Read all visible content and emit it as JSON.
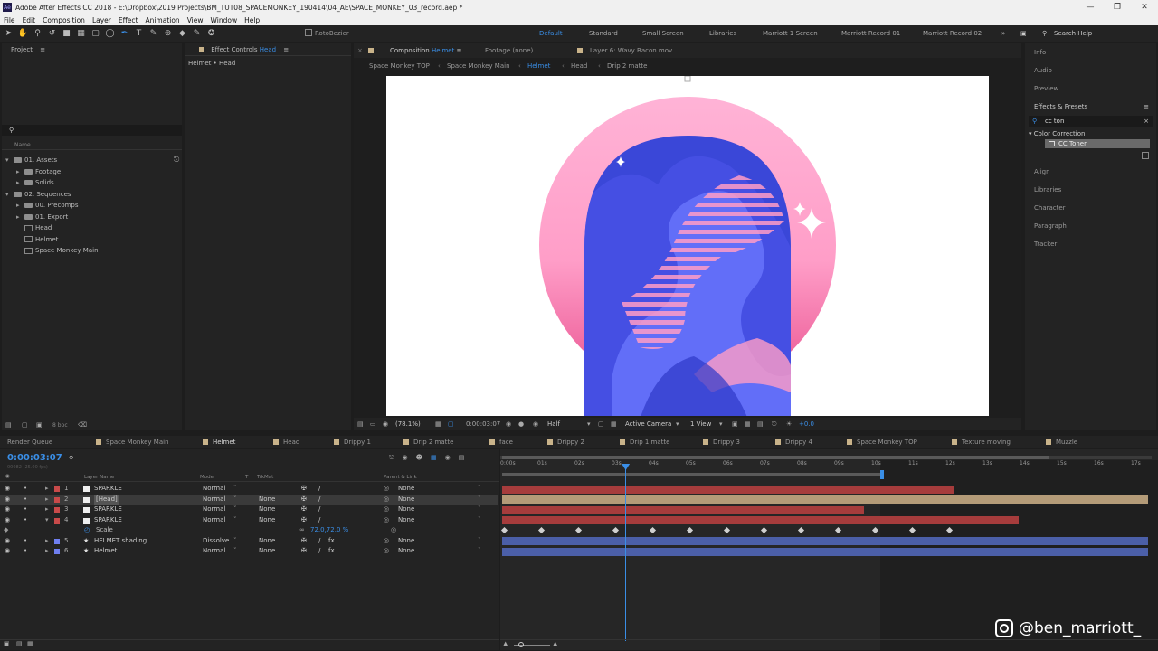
{
  "window": {
    "title": "Adobe After Effects CC 2018 - E:\\Dropbox\\2019 Projects\\BM_TUT08_SPACEMONKEY_190414\\04_AE\\SPACE_MONKEY_03_record.aep *",
    "logo": "Ae"
  },
  "menu": [
    "File",
    "Edit",
    "Composition",
    "Layer",
    "Effect",
    "Animation",
    "View",
    "Window",
    "Help"
  ],
  "toolbar": {
    "rotobezier": "RotoBezier",
    "workspaces": [
      "Default",
      "Standard",
      "Small Screen",
      "Libraries",
      "Marriott 1 Screen",
      "Marriott Record 01",
      "Marriott Record 02"
    ],
    "search_help": "Search Help"
  },
  "project": {
    "title": "Project",
    "search_placeholder": "",
    "column": "Name",
    "bpc": "8 bpc",
    "items": [
      {
        "label": "01. Assets",
        "type": "folder",
        "indent": 0,
        "open": true
      },
      {
        "label": "Footage",
        "type": "folder",
        "indent": 1
      },
      {
        "label": "Solids",
        "type": "folder",
        "indent": 1
      },
      {
        "label": "02. Sequences",
        "type": "folder",
        "indent": 0,
        "open": true
      },
      {
        "label": "00. Precomps",
        "type": "folder",
        "indent": 1
      },
      {
        "label": "01. Export",
        "type": "folder",
        "indent": 1
      },
      {
        "label": "Head",
        "type": "comp",
        "indent": 1
      },
      {
        "label": "Helmet",
        "type": "comp",
        "indent": 1
      },
      {
        "label": "Space Monkey Main",
        "type": "comp",
        "indent": 1
      }
    ]
  },
  "effect_controls": {
    "title": "Effect Controls",
    "layer": "Head",
    "subtitle": "Helmet • Head"
  },
  "composition": {
    "tab": "Composition",
    "name": "Helmet",
    "footage": "Footage (none)",
    "layer_tab": "Layer 6: Wavy Bacon.mov",
    "breadcrumbs": [
      "Space Monkey TOP",
      "Space Monkey Main",
      "Helmet",
      "Head",
      "Drip 2 matte"
    ],
    "zoom": "(78.1%)",
    "timecode": "0:00:03:07",
    "resolution": "Half",
    "camera": "Active Camera",
    "views": "1 View",
    "exposure": "+0.0"
  },
  "right_panel": {
    "items_top": [
      "Info",
      "Audio",
      "Preview"
    ],
    "effects_title": "Effects & Presets",
    "search": "cc ton",
    "category": "Color Correction",
    "result": "CC Toner",
    "items_bottom": [
      "Align",
      "Libraries",
      "Character",
      "Paragraph",
      "Tracker"
    ]
  },
  "timeline": {
    "tabs": [
      {
        "label": "Render Queue",
        "color": "",
        "active": false
      },
      {
        "label": "Space Monkey Main",
        "color": "#c9b38a",
        "active": false
      },
      {
        "label": "Helmet",
        "color": "#c9b38a",
        "active": true
      },
      {
        "label": "Head",
        "color": "#c9b38a",
        "active": false
      },
      {
        "label": "Drippy 1",
        "color": "#c9b38a",
        "active": false
      },
      {
        "label": "Drip 2 matte",
        "color": "#c9b38a",
        "active": false
      },
      {
        "label": "face",
        "color": "#c9b38a",
        "active": false
      },
      {
        "label": "Drippy 2",
        "color": "#c9b38a",
        "active": false
      },
      {
        "label": "Drip 1 matte",
        "color": "#c9b38a",
        "active": false
      },
      {
        "label": "Drippy 3",
        "color": "#c9b38a",
        "active": false
      },
      {
        "label": "Drippy 4",
        "color": "#c9b38a",
        "active": false
      },
      {
        "label": "Space Monkey TOP",
        "color": "#c9b38a",
        "active": false
      },
      {
        "label": "Texture moving",
        "color": "#c9b38a",
        "active": false
      },
      {
        "label": "Muzzle",
        "color": "#c9b38a",
        "active": false
      }
    ],
    "timecode": "0:00:03:07",
    "frame_info": "00082 (25.00 fps)",
    "columns": {
      "layer_name": "Layer Name",
      "mode": "Mode",
      "t": "T",
      "trkmat": "TrkMat",
      "parent": "Parent & Link"
    },
    "layers": [
      {
        "num": "1",
        "name": "SPARKLE",
        "mode": "Normal",
        "trk": "",
        "parent": "None",
        "label": "#c84a4a",
        "track_end": 0.7,
        "track_color": "#a63c3c"
      },
      {
        "num": "2",
        "name": "[Head]",
        "mode": "Normal",
        "trk": "None",
        "parent": "None",
        "label": "#c84a4a",
        "track_end": 1.0,
        "track_color": "#b49b78",
        "selected": true
      },
      {
        "num": "3",
        "name": "SPARKLE",
        "mode": "Normal",
        "trk": "None",
        "parent": "None",
        "label": "#c84a4a",
        "track_end": 0.56,
        "track_color": "#a63c3c"
      },
      {
        "num": "4",
        "name": "SPARKLE",
        "mode": "Normal",
        "trk": "None",
        "parent": "None",
        "label": "#c84a4a",
        "track_end": 0.8,
        "track_color": "#a63c3c",
        "open": true
      },
      {
        "num": "",
        "name": "Scale",
        "mode": "",
        "trk": "",
        "parent": "",
        "label": "",
        "is_prop": true,
        "value": "72.0,72.0 %"
      },
      {
        "num": "5",
        "name": "HELMET shading",
        "mode": "Dissolve",
        "trk": "None",
        "parent": "None",
        "label": "#6f7ff0",
        "track_end": 1.0,
        "track_color": "#4b5fa8",
        "star": true
      },
      {
        "num": "6",
        "name": "Helmet",
        "mode": "Normal",
        "trk": "None",
        "parent": "None",
        "label": "#6f7ff0",
        "track_end": 1.0,
        "track_color": "#4b5fa8",
        "star": true
      }
    ],
    "ruler": [
      "0:00s",
      "01s",
      "02s",
      "03s",
      "04s",
      "05s",
      "06s",
      "07s",
      "08s",
      "09s",
      "10s",
      "11s",
      "12s",
      "13s",
      "14s",
      "15s",
      "16s",
      "17s"
    ],
    "keyframes": [
      0,
      1,
      2,
      3,
      4,
      5,
      6,
      7,
      8,
      9,
      10,
      11,
      12
    ],
    "playhead": 0.19
  },
  "watermark": "@ben_marriott_",
  "colors": {
    "accent": "#3a8ee6",
    "pink": "#ff9ec8",
    "blue": "#4350e0"
  }
}
